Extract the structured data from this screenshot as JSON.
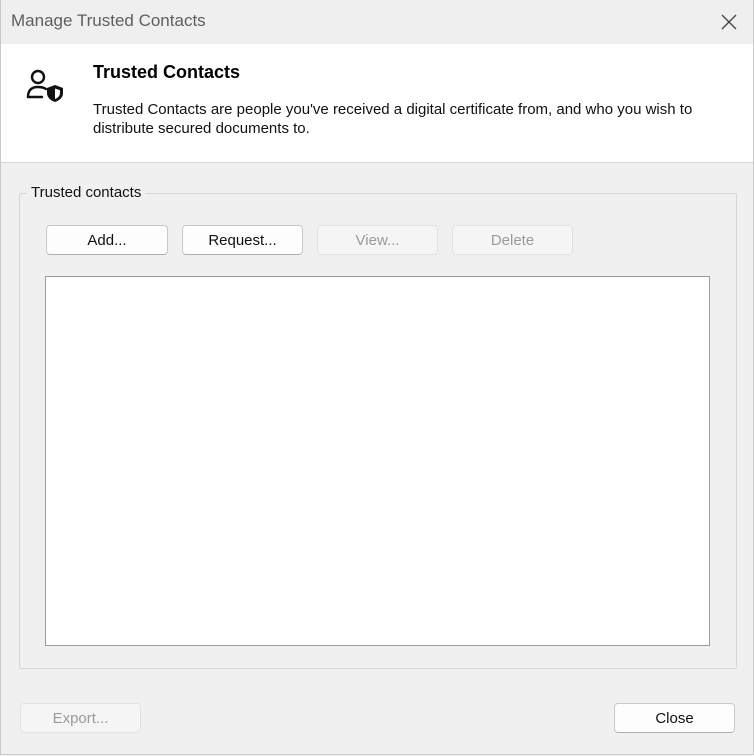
{
  "window": {
    "title": "Manage Trusted Contacts",
    "close_icon": "close-icon"
  },
  "header": {
    "icon": "person-shield-icon",
    "title": "Trusted Contacts",
    "description": "Trusted Contacts are people you've received a digital certificate from, and who you wish to distribute secured documents to."
  },
  "group": {
    "label": "Trusted contacts",
    "buttons": {
      "add": "Add...",
      "request": "Request...",
      "view": "View...",
      "delete": "Delete"
    },
    "contacts": []
  },
  "footer": {
    "export": "Export...",
    "close": "Close"
  },
  "colors": {
    "background": "#f0f0f0",
    "header_background": "#ffffff",
    "disabled_text": "#9a9a9a"
  }
}
